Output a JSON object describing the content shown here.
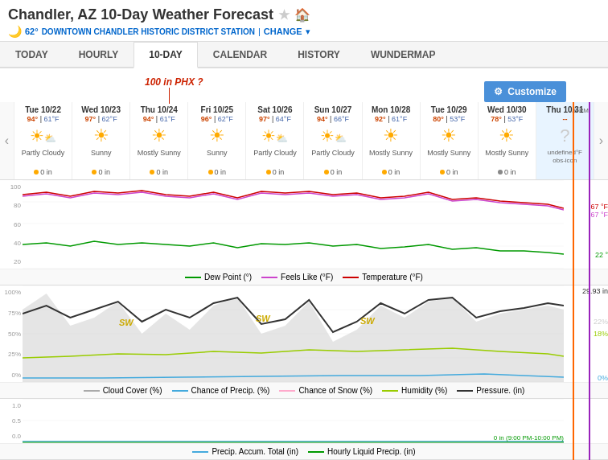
{
  "header": {
    "title": "Chandler, AZ 10-Day Weather Forecast",
    "temp": "62°",
    "station": "DOWNTOWN CHANDLER HISTORIC DISTRICT STATION",
    "change_label": "CHANGE"
  },
  "nav": {
    "tabs": [
      "TODAY",
      "HOURLY",
      "10-DAY",
      "CALENDAR",
      "HISTORY",
      "WUNDERMAP"
    ],
    "active": "10-DAY"
  },
  "customize_label": "Customize",
  "annotation": "100 in PHX ?",
  "forecast": {
    "days": [
      {
        "date": "Tue 10/22",
        "high": "94°",
        "low": "61°F",
        "icon": "☀",
        "partly": true,
        "desc": "Partly Cloudy",
        "precip": "0 in"
      },
      {
        "date": "Wed 10/23",
        "high": "97°",
        "low": "62°F",
        "icon": "☀",
        "partly": false,
        "desc": "Sunny",
        "precip": "0 in"
      },
      {
        "date": "Thu 10/24",
        "high": "94°",
        "low": "61°F",
        "icon": "☀",
        "partly": true,
        "desc": "Mostly Sunny",
        "precip": "0 in"
      },
      {
        "date": "Fri 10/25",
        "high": "96°",
        "low": "62°F",
        "icon": "☀",
        "partly": false,
        "desc": "Sunny",
        "precip": "0 in"
      },
      {
        "date": "Sat 10/26",
        "high": "97°",
        "low": "64°F",
        "icon": "☀",
        "partly": true,
        "desc": "Partly Cloudy",
        "precip": "0 in"
      },
      {
        "date": "Sun 10/27",
        "high": "94°",
        "low": "66°F",
        "icon": "☀",
        "partly": true,
        "desc": "Partly Cloudy",
        "precip": "0 in"
      },
      {
        "date": "Mon 10/28",
        "high": "92°",
        "low": "61°F",
        "icon": "☀",
        "partly": true,
        "desc": "Mostly Sunny",
        "precip": "0 in"
      },
      {
        "date": "Tue 10/29",
        "high": "80°",
        "low": "53°F",
        "icon": "☀",
        "partly": true,
        "desc": "Mostly Sunny",
        "precip": "0 in"
      },
      {
        "date": "Wed 10/30",
        "high": "78°",
        "low": "53°F",
        "icon": "☀",
        "partly": true,
        "desc": "Mostly Sunny",
        "precip": "0 in"
      },
      {
        "date": "Thu 10/31",
        "high": "--",
        "low": "undefined°F",
        "icon": "?",
        "partly": false,
        "desc": "obs-icon",
        "precip": ""
      }
    ]
  },
  "temp_chart": {
    "y_labels": [
      "100",
      "80",
      "60",
      "40",
      "20"
    ],
    "right_labels": [
      "67 °F",
      "67 °F",
      "22 °"
    ],
    "legend": [
      {
        "label": "Dew Point (°)",
        "color": "#009900"
      },
      {
        "label": "Feels Like (°F)",
        "color": "#cc44cc"
      },
      {
        "label": "Temperature (°F)",
        "color": "#cc0000"
      }
    ]
  },
  "cloud_chart": {
    "y_labels": [
      "100%",
      "75%",
      "50%",
      "25%",
      "0%"
    ],
    "right_labels": [
      "29.93 in",
      "22%",
      "18%",
      "0%"
    ],
    "annotations": [
      "SW",
      "SW",
      "SW"
    ],
    "legend": [
      {
        "label": "Cloud Cover (%)",
        "color": "#aaaaaa"
      },
      {
        "label": "Chance of Precip. (%)",
        "color": "#44aadd"
      },
      {
        "label": "Chance of Snow (%)",
        "color": "#ffaacc"
      },
      {
        "label": "Humidity (%)",
        "color": "#99cc00"
      },
      {
        "label": "Pressure. (in)",
        "color": "#333333"
      }
    ]
  },
  "precip_chart": {
    "y_labels": [
      "1.0",
      "0.5",
      "0.0"
    ],
    "time_label": "0 in (9:00 PM-10:00 PM)",
    "legend": [
      {
        "label": "Precip. Accum. Total (in)",
        "color": "#44aadd"
      },
      {
        "label": "Hourly Liquid Precip. (in)",
        "color": "#009900"
      }
    ]
  }
}
